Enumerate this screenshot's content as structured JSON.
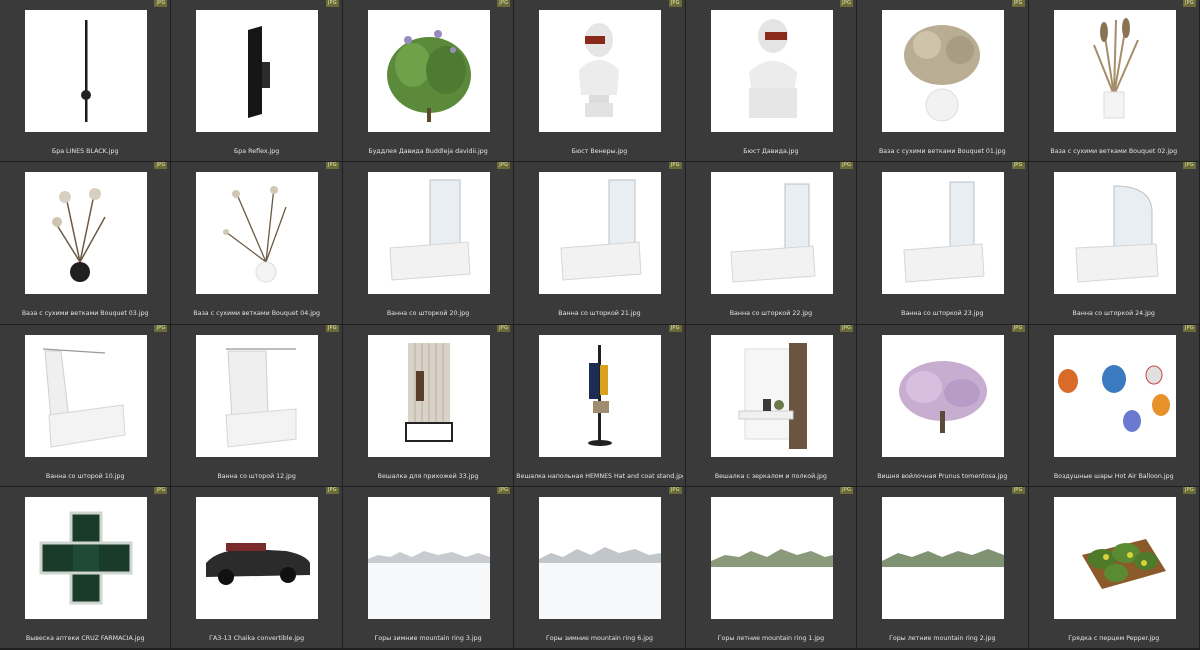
{
  "files": [
    {
      "name": "Бра LINES BLACK.jpg",
      "type": "JPG",
      "icon": "wall-lamp-lines-icon"
    },
    {
      "name": "Бра Reflex.jpg",
      "type": "JPG",
      "icon": "wall-lamp-reflex-icon"
    },
    {
      "name": "Буддлея Давида Buddleja davidii.jpg",
      "type": "JPG",
      "icon": "buddleja-plant-icon"
    },
    {
      "name": "Бюст Венеры.jpg",
      "type": "JPG",
      "icon": "venus-bust-icon"
    },
    {
      "name": "Бюст Давида.jpg",
      "type": "JPG",
      "icon": "david-bust-icon"
    },
    {
      "name": "Ваза с сухими ветками Bouquet 01.jpg",
      "type": "JPG",
      "icon": "vase-bouquet-icon"
    },
    {
      "name": "Ваза с сухими ветками Bouquet 02.jpg",
      "type": "JPG",
      "icon": "vase-bouquet-icon"
    },
    {
      "name": "Ваза с сухими ветками Bouquet 03.jpg",
      "type": "JPG",
      "icon": "vase-branches-icon"
    },
    {
      "name": "Ваза с сухими ветками Bouquet 04.jpg",
      "type": "JPG",
      "icon": "vase-branches-icon"
    },
    {
      "name": "Ванна со шторкой 20.jpg",
      "type": "JPG",
      "icon": "bathtub-glass-screen-icon"
    },
    {
      "name": "Ванна со шторкой 21.jpg",
      "type": "JPG",
      "icon": "bathtub-glass-screen-icon"
    },
    {
      "name": "Ванна со шторкой 22.jpg",
      "type": "JPG",
      "icon": "bathtub-glass-screen-icon"
    },
    {
      "name": "Ванна со шторкой 23.jpg",
      "type": "JPG",
      "icon": "bathtub-glass-screen-icon"
    },
    {
      "name": "Ванна со шторкой 24.jpg",
      "type": "JPG",
      "icon": "bathtub-glass-screen-icon"
    },
    {
      "name": "Ванна со шторой 10.jpg",
      "type": "JPG",
      "icon": "bathtub-curtain-icon"
    },
    {
      "name": "Ванна со шторой 12.jpg",
      "type": "JPG",
      "icon": "bathtub-curtain-icon"
    },
    {
      "name": "Вешалка для прихожей 33.jpg",
      "type": "JPG",
      "icon": "hallway-rack-icon"
    },
    {
      "name": "Вешалка напольная HEMNES Hat and coat stand.jpg",
      "type": "JPG",
      "icon": "coat-stand-icon"
    },
    {
      "name": "Вешалка с зеркалом и полкой.jpg",
      "type": "JPG",
      "icon": "mirror-shelf-icon"
    },
    {
      "name": "Вишня войлочная Prunus tomentosa.jpg",
      "type": "JPG",
      "icon": "cherry-tree-icon"
    },
    {
      "name": "Воздушные шары Hot Air Balloon.jpg",
      "type": "JPG",
      "icon": "hot-air-balloons-icon"
    },
    {
      "name": "Вывеска аптеки CRUZ FARMACIA.jpg",
      "type": "JPG",
      "icon": "pharmacy-cross-sign-icon"
    },
    {
      "name": "ГАЗ-13 Chaika convertible.jpg",
      "type": "JPG",
      "icon": "convertible-car-icon"
    },
    {
      "name": "Горы зимние mountain ring 3.jpg",
      "type": "JPG",
      "icon": "winter-mountains-icon"
    },
    {
      "name": "Горы зимние mountain ring 6.jpg",
      "type": "JPG",
      "icon": "winter-mountains-icon"
    },
    {
      "name": "Горы летние mountain ring 1.jpg",
      "type": "JPG",
      "icon": "summer-mountains-icon"
    },
    {
      "name": "Горы летние mountain ring 2.jpg",
      "type": "JPG",
      "icon": "summer-mountains-icon"
    },
    {
      "name": "Грядка с перцем Pepper.jpg",
      "type": "JPG",
      "icon": "pepper-garden-bed-icon"
    }
  ]
}
